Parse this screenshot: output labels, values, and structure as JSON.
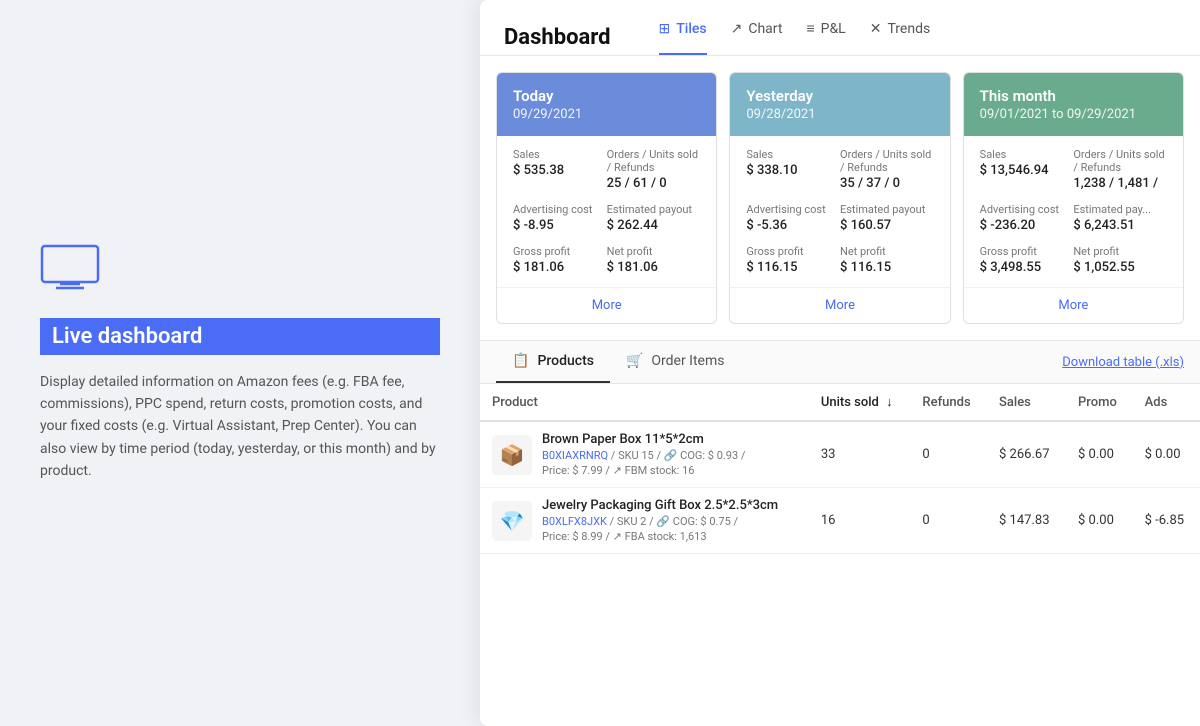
{
  "sidebar": {
    "title": "Live dashboard",
    "description": "Display detailed information on Amazon fees (e.g. FBA fee, commissions), PPC spend, return costs, promotion costs, and your fixed costs (e.g. Virtual Assistant, Prep Center). You can also view by time period (today, yesterday, or this month) and by product."
  },
  "header": {
    "title": "Dashboard",
    "tabs": [
      {
        "id": "tiles",
        "label": "Tiles",
        "icon": "⊞",
        "active": true
      },
      {
        "id": "chart",
        "label": "Chart",
        "icon": "↗",
        "active": false
      },
      {
        "id": "pl",
        "label": "P&L",
        "icon": "≡",
        "active": false
      },
      {
        "id": "trends",
        "label": "Trends",
        "icon": "✕",
        "active": false
      }
    ]
  },
  "tiles": [
    {
      "id": "today",
      "header_class": "today",
      "title": "Today",
      "date": "09/29/2021",
      "sales_label": "Sales",
      "sales_value": "$ 535.38",
      "orders_label": "Orders / Units sold / Refunds",
      "orders_value": "25 / 61 / 0",
      "adcost_label": "Advertising cost",
      "adcost_value": "$ -8.95",
      "payout_label": "Estimated payout",
      "payout_value": "$ 262.44",
      "gross_label": "Gross profit",
      "gross_value": "$ 181.06",
      "net_label": "Net profit",
      "net_value": "$ 181.06",
      "more_label": "More"
    },
    {
      "id": "yesterday",
      "header_class": "yesterday",
      "title": "Yesterday",
      "date": "09/28/2021",
      "sales_label": "Sales",
      "sales_value": "$ 338.10",
      "orders_label": "Orders / Units sold / Refunds",
      "orders_value": "35 / 37 / 0",
      "adcost_label": "Advertising cost",
      "adcost_value": "$ -5.36",
      "payout_label": "Estimated payout",
      "payout_value": "$ 160.57",
      "gross_label": "Gross profit",
      "gross_value": "$ 116.15",
      "net_label": "Net profit",
      "net_value": "$ 116.15",
      "more_label": "More"
    },
    {
      "id": "thismonth",
      "header_class": "thismonth",
      "title": "This month",
      "date": "09/01/2021 to 09/29/2021",
      "sales_label": "Sales",
      "sales_value": "$ 13,546.94",
      "orders_label": "Orders / Units sold / Refunds",
      "orders_value": "1,238 / 1,481 /",
      "adcost_label": "Advertising cost",
      "adcost_value": "$ -236.20",
      "payout_label": "Estimated pay...",
      "payout_value": "$ 6,243.51",
      "gross_label": "Gross profit",
      "gross_value": "$ 3,498.55",
      "net_label": "Net profit",
      "net_value": "$ 1,052.55",
      "more_label": "More"
    }
  ],
  "products_section": {
    "tabs": [
      {
        "id": "products",
        "label": "Products",
        "icon": "📋",
        "active": true
      },
      {
        "id": "order-items",
        "label": "Order Items",
        "icon": "🛒",
        "active": false
      }
    ],
    "download_label": "Download table (.xls)",
    "table": {
      "columns": [
        {
          "id": "product",
          "label": "Product"
        },
        {
          "id": "units-sold",
          "label": "Units sold",
          "sort": true
        },
        {
          "id": "refunds",
          "label": "Refunds"
        },
        {
          "id": "sales",
          "label": "Sales"
        },
        {
          "id": "promo",
          "label": "Promo"
        },
        {
          "id": "ads",
          "label": "Ads"
        }
      ],
      "rows": [
        {
          "thumb": "📦",
          "name": "Brown Paper Box 11*5*2cm",
          "asin": "B0XIAXRNRQ",
          "sku": "SKU 15",
          "cog": "COG: $ 0.93",
          "price": "Price: $ 7.99",
          "stock": "FBM stock: 16",
          "units_sold": "33",
          "refunds": "0",
          "sales": "$ 266.67",
          "promo": "$ 0.00",
          "ads": "$ 0.00"
        },
        {
          "thumb": "💎",
          "name": "Jewelry Packaging Gift Box 2.5*2.5*3cm",
          "asin": "B0XLFX8JXK",
          "sku": "SKU 2",
          "cog": "COG: $ 0.75",
          "price": "Price: $ 8.99",
          "stock": "FBA stock: 1,613",
          "units_sold": "16",
          "refunds": "0",
          "sales": "$ 147.83",
          "promo": "$ 0.00",
          "ads": "$ -6.85"
        }
      ]
    }
  }
}
